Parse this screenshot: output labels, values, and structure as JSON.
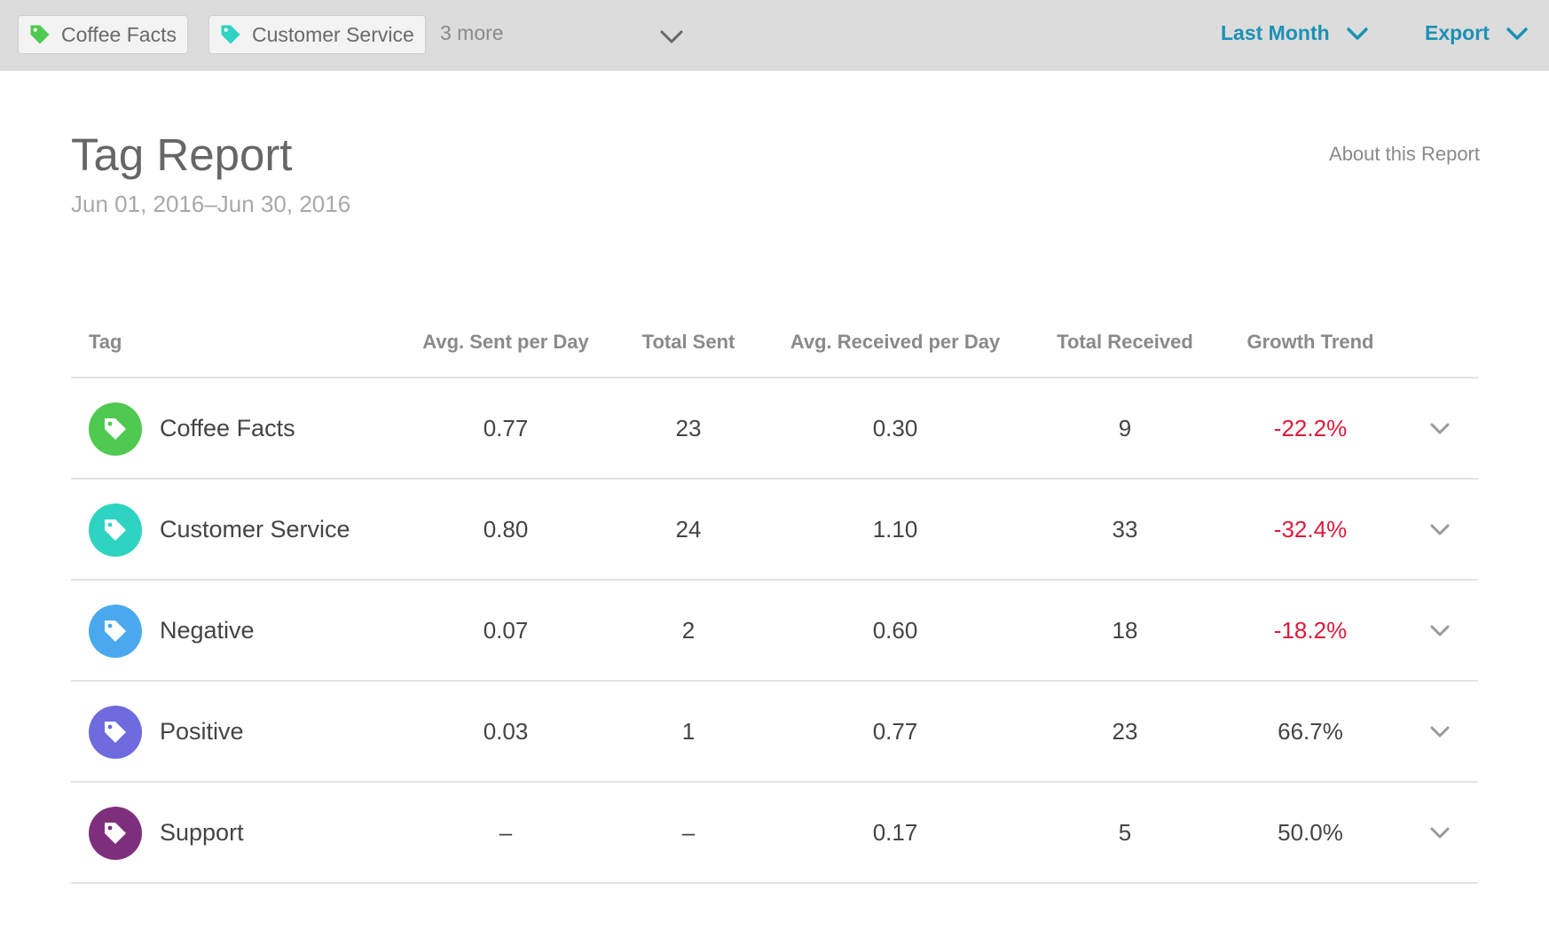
{
  "filter_bar": {
    "chips": [
      {
        "label": "Coffee Facts",
        "color": "#4fc94f"
      },
      {
        "label": "Customer Service",
        "color": "#2fd3c1"
      }
    ],
    "more_label": "3 more",
    "date_range_label": "Last Month",
    "export_label": "Export",
    "accent_color": "#1a91b5"
  },
  "report": {
    "title": "Tag Report",
    "date_range": "Jun 01, 2016–Jun 30, 2016",
    "about_link": "About this Report"
  },
  "table": {
    "headers": {
      "tag": "Tag",
      "avg_sent": "Avg. Sent per Day",
      "total_sent": "Total Sent",
      "avg_received": "Avg. Received per Day",
      "total_received": "Total Received",
      "growth": "Growth Trend"
    },
    "rows": [
      {
        "tag": "Coffee Facts",
        "color": "#4fc94f",
        "avg_sent": "0.77",
        "total_sent": "23",
        "avg_received": "0.30",
        "total_received": "9",
        "growth": "-22.2%",
        "negative": true
      },
      {
        "tag": "Customer Service",
        "color": "#2fd3c1",
        "avg_sent": "0.80",
        "total_sent": "24",
        "avg_received": "1.10",
        "total_received": "33",
        "growth": "-32.4%",
        "negative": true
      },
      {
        "tag": "Negative",
        "color": "#4aa9ee",
        "avg_sent": "0.07",
        "total_sent": "2",
        "avg_received": "0.60",
        "total_received": "18",
        "growth": "-18.2%",
        "negative": true
      },
      {
        "tag": "Positive",
        "color": "#6e6bdf",
        "avg_sent": "0.03",
        "total_sent": "1",
        "avg_received": "0.77",
        "total_received": "23",
        "growth": "66.7%",
        "negative": false
      },
      {
        "tag": "Support",
        "color": "#7e2f7c",
        "avg_sent": "–",
        "total_sent": "–",
        "avg_received": "0.17",
        "total_received": "5",
        "growth": "50.0%",
        "negative": false
      }
    ],
    "negative_color": "#e0193a"
  }
}
